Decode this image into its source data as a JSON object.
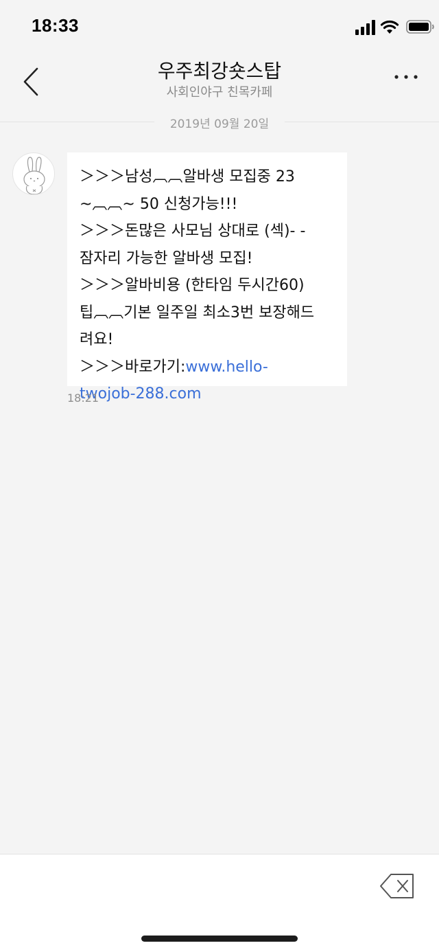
{
  "status_bar": {
    "time": "18:33",
    "icons": [
      "signal-icon",
      "wifi-icon",
      "battery-icon"
    ]
  },
  "header": {
    "title": "우주최강숏스탑",
    "subtitle": "사회인야구 친목카페",
    "back_icon": "chevron-left-icon",
    "more_icon": "more-horizontal-icon"
  },
  "date_divider": "2019년 09월 20일",
  "message": {
    "avatar_icon": "rabbit-avatar-icon",
    "lines": [
      "＞＞＞남성︹︹알바생 모집중 23",
      "~︹︹~ 50 신청가능!!!",
      "＞＞＞돈많은 사모님 상대로 (섹)- -",
      "잠자리 가능한 알바생 모집!",
      "＞＞＞알바비용 (한타임 두시간60)",
      "팁︹︹기본 일주일 최소3번 보장해드",
      "려요!"
    ],
    "link_prefix": "＞＞＞바로가기:",
    "link_part1": "www.hello-",
    "link_part2": "twojob-288.com",
    "time": "18:21"
  },
  "bottom": {
    "exit_icon": "exit-chat-icon"
  },
  "colors": {
    "background": "#f4f4f4",
    "bubble": "#ffffff",
    "link": "#3a6fd8",
    "muted": "#8f8f8f"
  }
}
